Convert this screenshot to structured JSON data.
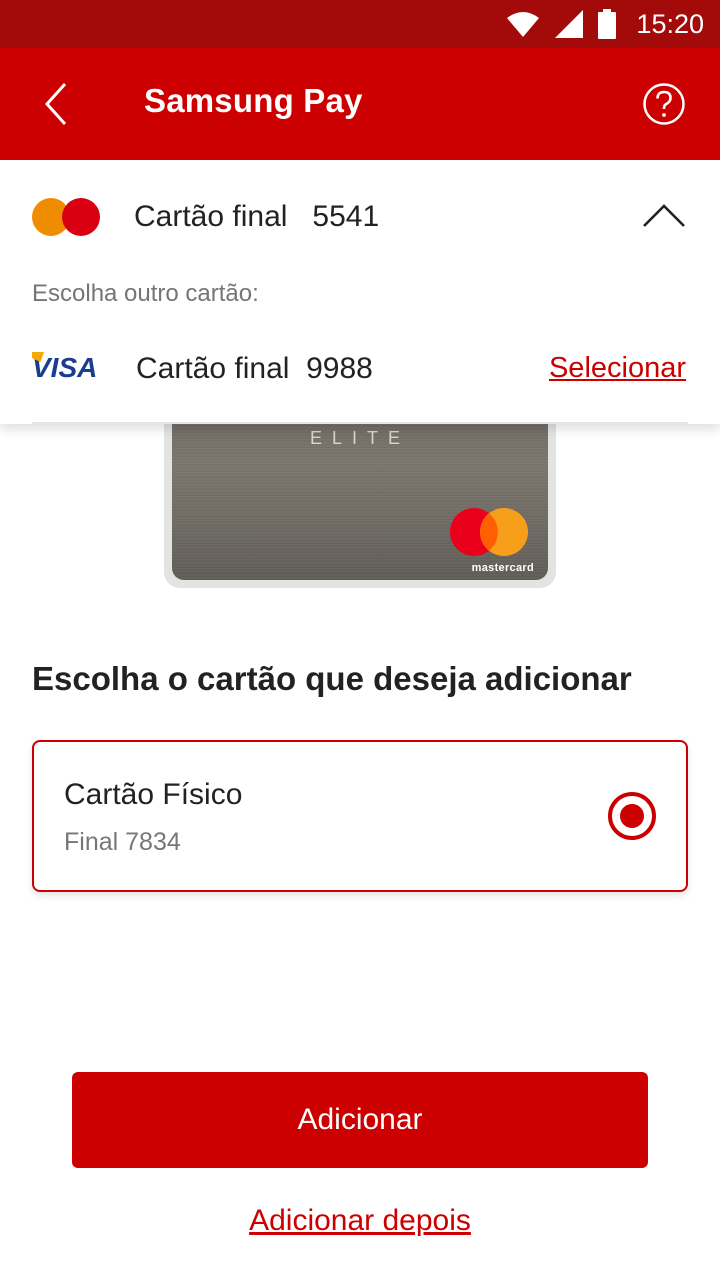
{
  "status_bar": {
    "time": "15:20",
    "icons": [
      "wifi-icon",
      "signal-icon",
      "battery-icon"
    ]
  },
  "app_bar": {
    "title": "Samsung Pay",
    "back_icon": "chevron-left-icon",
    "help_icon": "help-circle-icon"
  },
  "card_picker": {
    "selected": {
      "brand": "mastercard",
      "label": "Cartão final   5541"
    },
    "other_label": "Escolha outro cartão:",
    "options": [
      {
        "brand": "VISA",
        "label": "Cartão final  9988",
        "action": "Selecionar"
      }
    ]
  },
  "card_preview": {
    "tier": "ELITE",
    "network": "mastercard"
  },
  "main": {
    "heading": "Escolha o cartão que deseja adicionar",
    "options": [
      {
        "title": "Cartão Físico",
        "subtitle": "Final 7834",
        "selected": true
      }
    ]
  },
  "actions": {
    "primary": "Adicionar",
    "secondary": "Adicionar depois"
  },
  "colors": {
    "brand_red": "#cc0000",
    "status_bar": "#a30a0a",
    "mc_red": "#eb001b",
    "mc_orange": "#f79e1b",
    "visa_blue": "#1a3e8f"
  }
}
